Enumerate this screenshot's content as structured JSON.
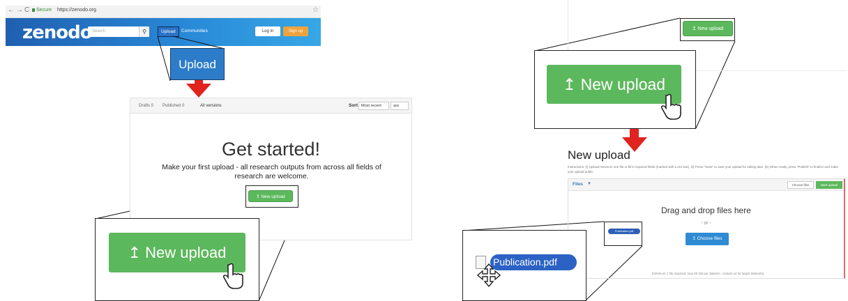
{
  "browser": {
    "back": "←",
    "forward": "→",
    "reload": "C",
    "secure": "Secure",
    "url": "https://zenodo.org",
    "star": "☆"
  },
  "header": {
    "logo": "zenodo",
    "search_placeholder": "Search",
    "upload_link": "Upload",
    "communities_link": "Communities",
    "login": "Log in",
    "signup": "Sign up"
  },
  "upload_zoom_label": "Upload",
  "left_panel": {
    "toolbar": {
      "drafts": "Drafts 0",
      "published": "Published 0",
      "all_versions": "All versions",
      "sort_label": "Sort",
      "sort_value": "Most recent",
      "order_value": "asc"
    },
    "title": "Get started!",
    "intro": "Make your first upload - all research outputs from across all fields of research are welcome.",
    "new_upload_label": "New upload",
    "zoom_new_upload_label": "New upload"
  },
  "right_panel": {
    "top_new_upload_label": "New upload",
    "zoom_new_upload_label": "New upload",
    "heading": "New upload",
    "instructions": "Instructions: (i) Upload minimum one file or fill in required fields (marked with a red star). (ii) Press \"Save\" to save your upload for editing later. (iii) When ready, press \"Publish\" to finalize and make your upload public.",
    "files_label": "Files",
    "choose_files_top": "Choose files",
    "start_upload_top": "Start upload",
    "drag_drop": "Drag and drop files here",
    "or": "- or -",
    "choose_files_btn": "Choose files",
    "upload_note": "(minimum 1 file required, max 50 GB per dataset - contact us for larger datasets)",
    "tiny_file_name": "Publication.pdf",
    "file_name": "Publication.pdf"
  },
  "colors": {
    "zenodo_blue": "#1f5fb0",
    "green_button": "#5cb85c",
    "arrow_red": "#e0231f",
    "signup_orange": "#f0a23c"
  }
}
